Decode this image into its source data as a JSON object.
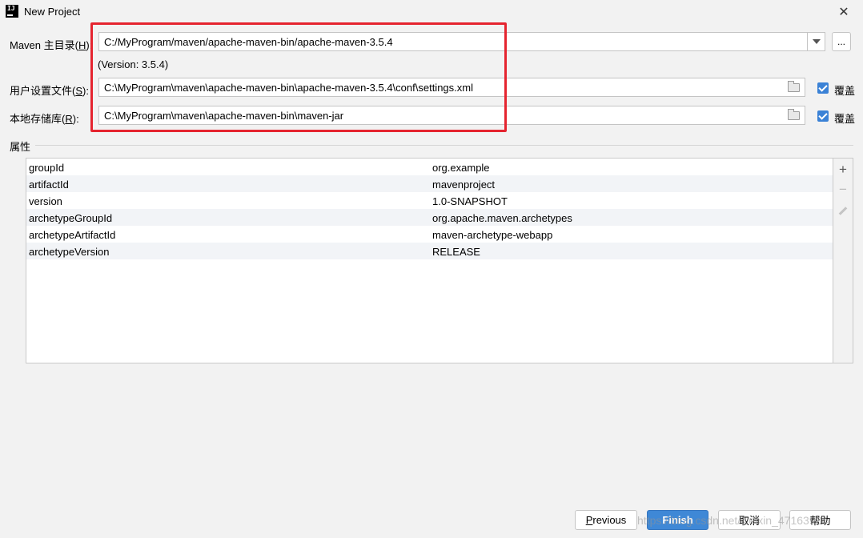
{
  "window": {
    "title": "New Project"
  },
  "maven_home": {
    "label": "Maven 主目录(",
    "mnemonic": "H",
    "label_end": "):",
    "value": "C:/MyProgram/maven/apache-maven-bin/apache-maven-3.5.4",
    "browse": "...",
    "version": "(Version: 3.5.4)"
  },
  "user_settings": {
    "label": "用户设置文件(",
    "mnemonic": "S",
    "label_end": "):",
    "value": "C:\\MyProgram\\maven\\apache-maven-bin\\apache-maven-3.5.4\\conf\\settings.xml",
    "override_label": "覆盖",
    "override_checked": true
  },
  "local_repo": {
    "label": "本地存储库(",
    "mnemonic": "R",
    "label_end": "):",
    "value": "C:\\MyProgram\\maven\\apache-maven-bin\\maven-jar",
    "override_label": "覆盖",
    "override_checked": true
  },
  "properties": {
    "label": "属性",
    "rows": [
      {
        "key": "groupId",
        "value": "org.example"
      },
      {
        "key": "artifactId",
        "value": "mavenproject"
      },
      {
        "key": "version",
        "value": "1.0-SNAPSHOT"
      },
      {
        "key": "archetypeGroupId",
        "value": "org.apache.maven.archetypes"
      },
      {
        "key": "archetypeArtifactId",
        "value": "maven-archetype-webapp"
      },
      {
        "key": "archetypeVersion",
        "value": "RELEASE"
      }
    ]
  },
  "buttons": {
    "previous_mnemonic": "P",
    "previous_rest": "revious",
    "finish": "Finish",
    "cancel": "取消",
    "help": "帮助"
  },
  "watermark": "https://blog.csdn.net/weixin_47163984",
  "colors": {
    "accent": "#3f88d6",
    "highlight": "#e5242f",
    "checkbox": "#3b82d6"
  }
}
